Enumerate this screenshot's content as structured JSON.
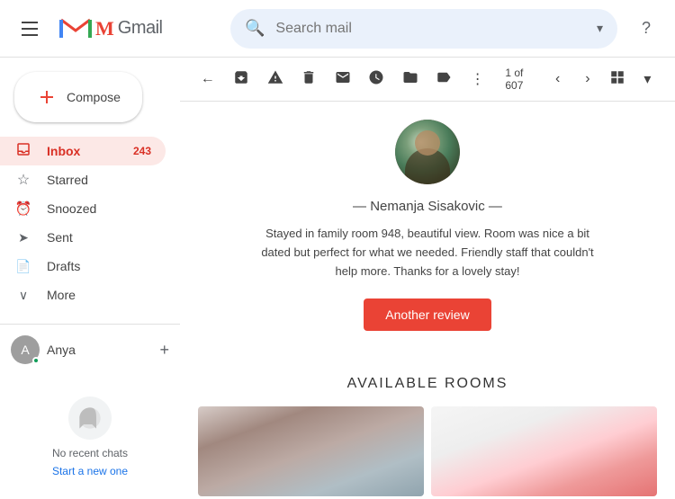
{
  "header": {
    "menu_icon": "☰",
    "logo_m": "M",
    "logo_text": "Gmail",
    "search_placeholder": "Search mail",
    "help_icon": "?",
    "chevron": "▾"
  },
  "sidebar": {
    "compose_label": "Compose",
    "nav_items": [
      {
        "id": "inbox",
        "label": "Inbox",
        "icon": "📥",
        "badge": "243",
        "active": true
      },
      {
        "id": "starred",
        "label": "Starred",
        "icon": "★",
        "badge": "",
        "active": false
      },
      {
        "id": "snoozed",
        "label": "Snoozed",
        "icon": "🕐",
        "badge": "",
        "active": false
      },
      {
        "id": "sent",
        "label": "Sent",
        "icon": "➤",
        "badge": "",
        "active": false
      },
      {
        "id": "drafts",
        "label": "Drafts",
        "icon": "📄",
        "badge": "",
        "active": false
      },
      {
        "id": "more",
        "label": "More",
        "icon": "∨",
        "badge": "",
        "active": false
      }
    ],
    "chat_user": "Anya",
    "no_recent_chats": "No recent chats",
    "start_new_label": "Start a new one"
  },
  "toolbar": {
    "back_icon": "←",
    "archive_icon": "🗃",
    "report_icon": "⚠",
    "delete_icon": "🗑",
    "email_icon": "✉",
    "clock_icon": "🕐",
    "folder_icon": "📁",
    "label_icon": "🏷",
    "more_icon": "⋮",
    "pagination": "1 of 607",
    "prev_icon": "‹",
    "next_icon": "›",
    "grid_icon": "⊞"
  },
  "email": {
    "reviewer": {
      "name": "— Nemanja Sisakovic —",
      "review": "Stayed in family room 948, beautiful view. Room was nice a bit dated but perfect for what we needed. Friendly staff that couldn't help more. Thanks for a lovely stay!",
      "another_review_btn": "Another review"
    },
    "available_rooms": {
      "title": "AVAILABLE ROOMS",
      "rooms": [
        {
          "id": "room1",
          "style": "left"
        },
        {
          "id": "room2",
          "style": "right"
        }
      ]
    }
  }
}
